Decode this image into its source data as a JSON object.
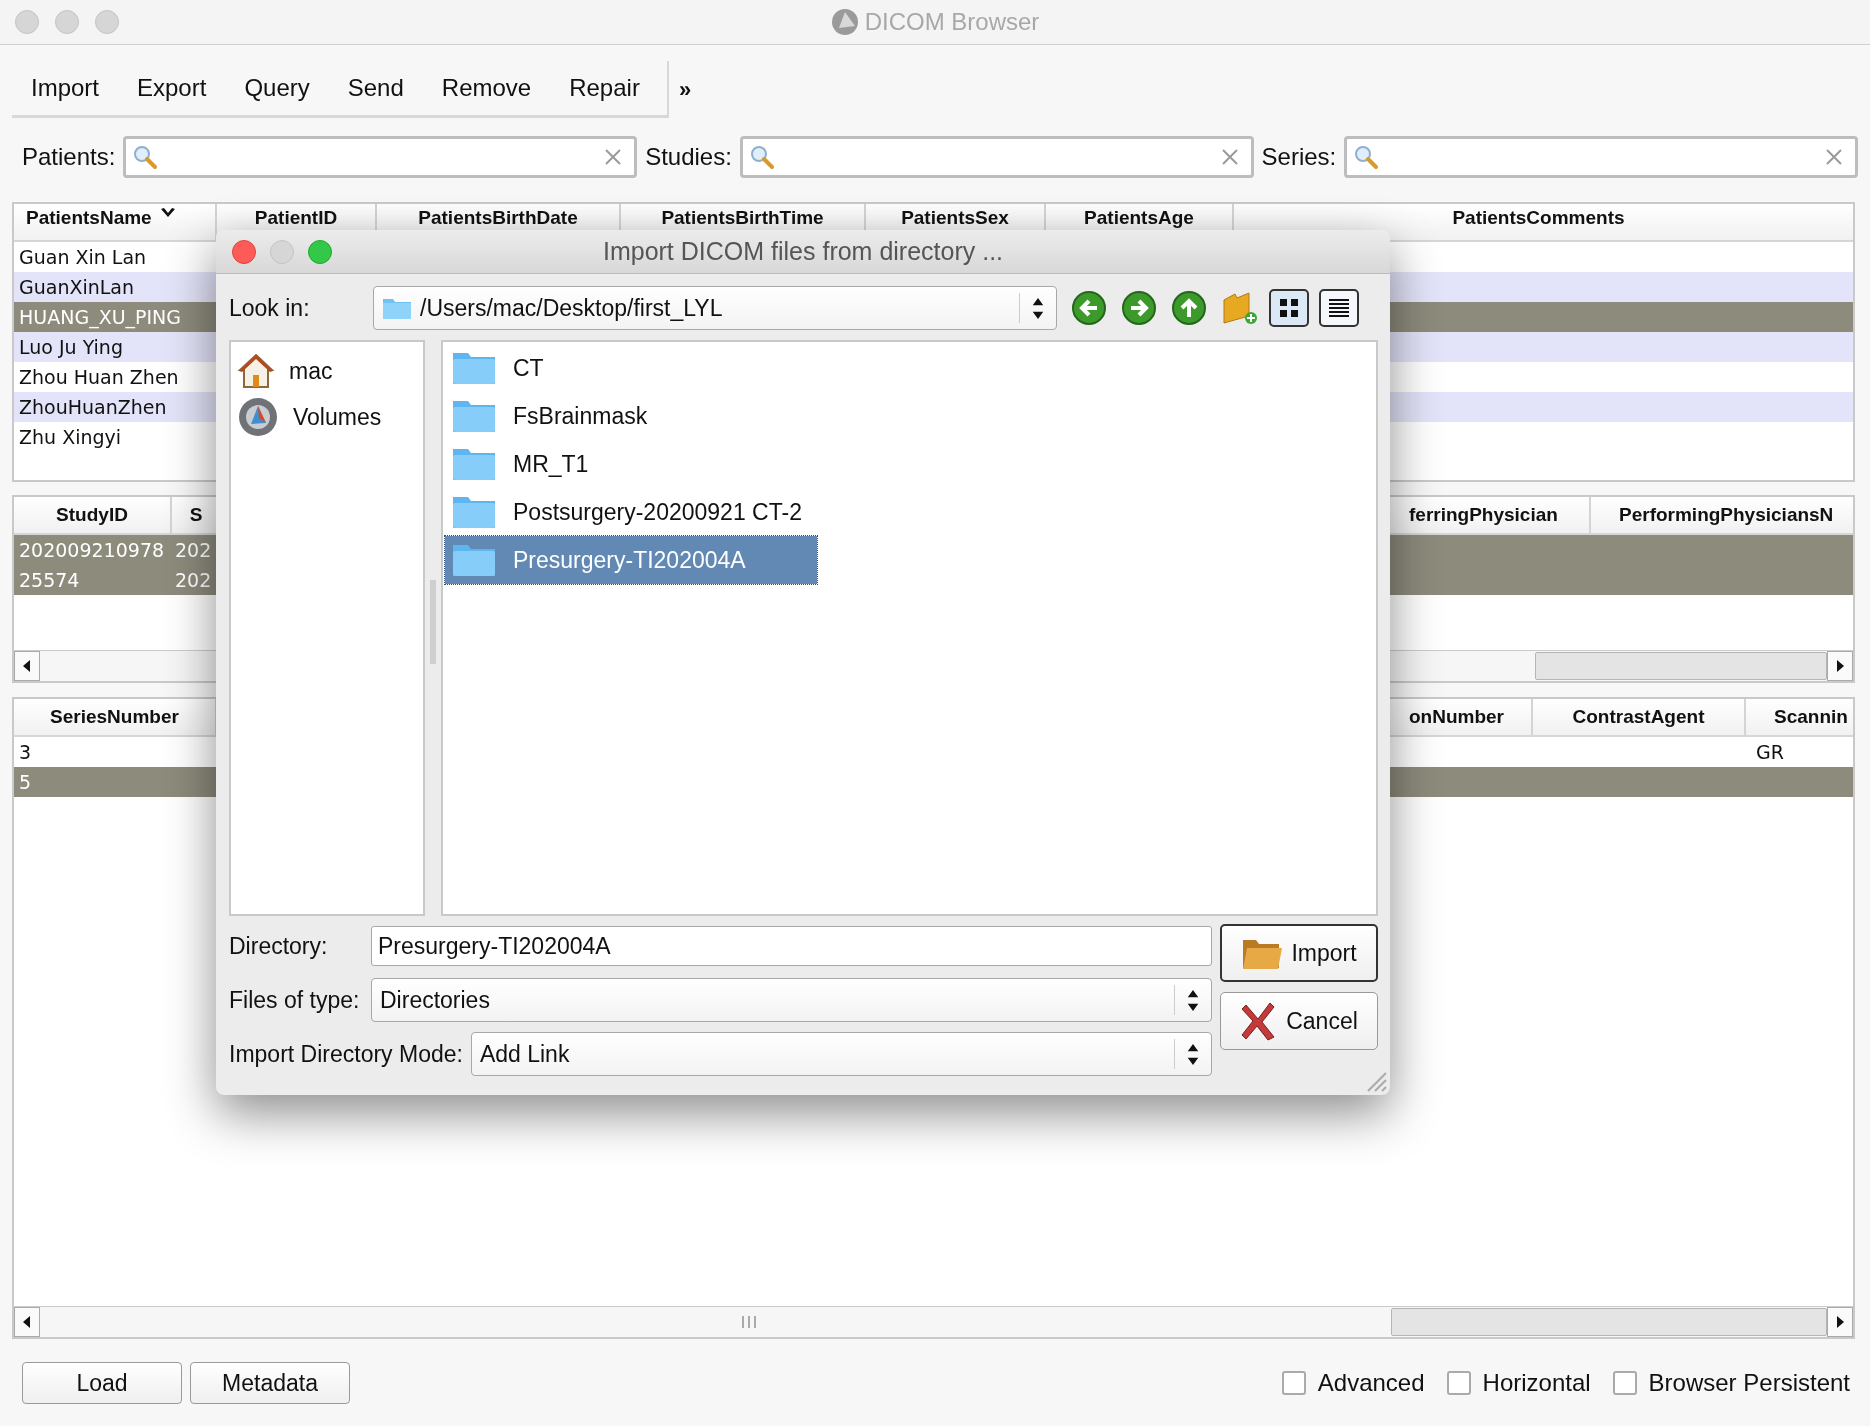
{
  "window": {
    "title": "DICOM Browser"
  },
  "toolbar": {
    "items": [
      "Import",
      "Export",
      "Query",
      "Send",
      "Remove",
      "Repair"
    ],
    "overflow": "»"
  },
  "search_fields": [
    {
      "label": "Patients:"
    },
    {
      "label": "Studies:"
    },
    {
      "label": "Series:"
    }
  ],
  "patients_table": {
    "columns": [
      "PatientsName",
      "PatientID",
      "PatientsBirthDate",
      "PatientsBirthTime",
      "PatientsSex",
      "PatientsAge",
      "PatientsComments"
    ],
    "rows": [
      {
        "name": "Guan Xin Lan",
        "selected": false
      },
      {
        "name": "GuanXinLan",
        "selected": false
      },
      {
        "name": "HUANG_XU_PING",
        "selected": true
      },
      {
        "name": "Luo Ju Ying",
        "selected": false
      },
      {
        "name": "Zhou Huan Zhen",
        "selected": false
      },
      {
        "name": "ZhouHuanZhen",
        "selected": false
      },
      {
        "name": "Zhu Xingyi",
        "selected": false
      }
    ]
  },
  "studies_table": {
    "left_columns": [
      "StudyID",
      "S"
    ],
    "right_columns": [
      "ferringPhysician",
      "PerformingPhysiciansN"
    ],
    "rows": [
      {
        "cells": [
          "202009210978",
          "202"
        ],
        "selected": true
      },
      {
        "cells": [
          "25574",
          "202"
        ],
        "selected": true
      }
    ]
  },
  "series_table": {
    "left_columns": [
      "SeriesNumber"
    ],
    "right_columns": [
      "onNumber",
      "ContrastAgent",
      "Scannin"
    ],
    "rows": [
      {
        "series_number": "3",
        "scannin": "GR",
        "selected": false
      },
      {
        "series_number": "5",
        "selected": true
      }
    ]
  },
  "bottom_bar": {
    "buttons": [
      "Load",
      "Metadata"
    ],
    "checkboxes": [
      {
        "label": "Advanced",
        "checked": false
      },
      {
        "label": "Horizontal",
        "checked": false
      },
      {
        "label": "Browser Persistent",
        "checked": false
      }
    ]
  },
  "dialog": {
    "title": "Import DICOM files from directory ...",
    "look_in": {
      "label": "Look in:",
      "value": "/Users/mac/Desktop/first_LYL"
    },
    "places": [
      {
        "label": "mac",
        "kind": "home"
      },
      {
        "label": "Volumes",
        "kind": "disk"
      }
    ],
    "files": [
      {
        "name": "CT",
        "selected": false
      },
      {
        "name": "FsBrainmask",
        "selected": false
      },
      {
        "name": "MR_T1",
        "selected": false
      },
      {
        "name": "Postsurgery-20200921 CT-2",
        "selected": false
      },
      {
        "name": "Presurgery-TI202004A",
        "selected": true
      }
    ],
    "directory": {
      "label": "Directory:",
      "value": "Presurgery-TI202004A"
    },
    "file_type": {
      "label": "Files of type:",
      "value": "Directories"
    },
    "mode": {
      "label": "Import Directory Mode:",
      "value": "Add Link"
    },
    "buttons": [
      {
        "label": "Import",
        "kind": "import"
      },
      {
        "label": "Cancel",
        "kind": "cancel"
      }
    ]
  }
}
